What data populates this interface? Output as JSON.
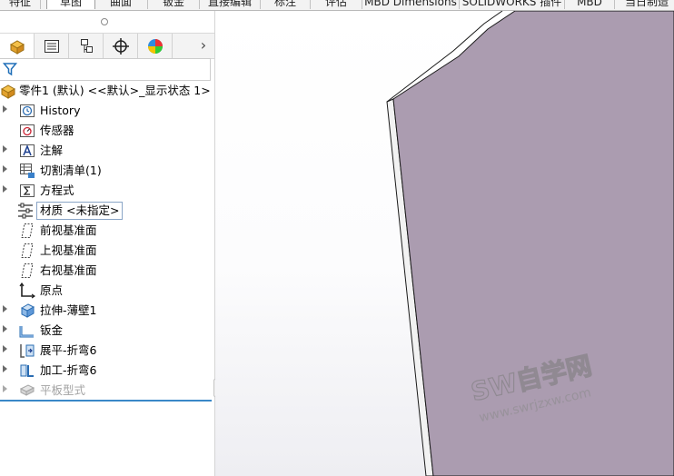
{
  "ribbon": {
    "tabs": [
      {
        "label": "特征",
        "active": false
      },
      {
        "label": "草图",
        "active": true
      },
      {
        "label": "曲面",
        "active": false
      },
      {
        "label": "钣金",
        "active": false
      },
      {
        "label": "直接编辑",
        "active": false
      },
      {
        "label": "标注",
        "active": false
      },
      {
        "label": "评估",
        "active": false
      },
      {
        "label": "MBD Dimensions",
        "active": false
      },
      {
        "label": "SOLIDWORKS 插件",
        "active": false
      },
      {
        "label": "MBD",
        "active": false
      },
      {
        "label": "当日制造",
        "active": false
      }
    ]
  },
  "panel": {
    "tabs": [
      {
        "name": "featuremanager-tab",
        "icon": "part-icon",
        "active": true
      },
      {
        "name": "propertymanager-tab",
        "icon": "property-list-icon",
        "active": false
      },
      {
        "name": "configurationmanager-tab",
        "icon": "configuration-icon",
        "active": false
      },
      {
        "name": "dimxpert-tab",
        "icon": "crosshair-icon",
        "active": false
      },
      {
        "name": "displaymanager-tab",
        "icon": "appearance-pie-icon",
        "active": false
      }
    ],
    "more": "›",
    "filter_icon": "filter-icon"
  },
  "tree": {
    "root": "零件1 (默认) <<默认>_显示状态 1>",
    "items": [
      {
        "label": "History",
        "icon": "history-folder-icon",
        "expandable": true
      },
      {
        "label": "传感器",
        "icon": "sensor-icon",
        "expandable": false
      },
      {
        "label": "注解",
        "icon": "annotation-icon",
        "expandable": true
      },
      {
        "label": "切割清单(1)",
        "icon": "cut-list-icon",
        "expandable": true
      },
      {
        "label": "方程式",
        "icon": "equation-icon",
        "expandable": true
      },
      {
        "label": "材质 <未指定>",
        "icon": "material-icon",
        "expandable": false
      },
      {
        "label": "前视基准面",
        "icon": "plane-icon",
        "expandable": false
      },
      {
        "label": "上视基准面",
        "icon": "plane-icon",
        "expandable": false
      },
      {
        "label": "右视基准面",
        "icon": "plane-icon",
        "expandable": false
      },
      {
        "label": "原点",
        "icon": "origin-icon",
        "expandable": false
      },
      {
        "label": "拉伸-薄壁1",
        "icon": "extrude-icon",
        "expandable": true
      },
      {
        "label": "钣金",
        "icon": "sheet-metal-icon",
        "expandable": true
      },
      {
        "label": "展平-折弯6",
        "icon": "unfold-icon",
        "expandable": true
      },
      {
        "label": "加工-折弯6",
        "icon": "fold-icon",
        "expandable": true
      },
      {
        "label": "平板型式",
        "icon": "flat-pattern-icon",
        "expandable": true
      }
    ]
  },
  "viewport": {
    "watermark_main": "SW自学网",
    "watermark_url": "www.swrjzxw.com",
    "part_color": "#ab9cb0"
  }
}
